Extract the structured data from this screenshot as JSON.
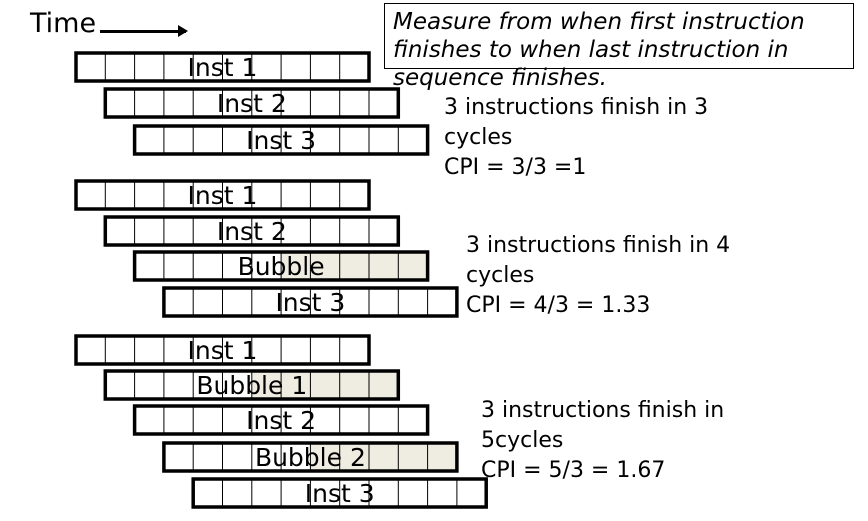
{
  "header": {
    "time_label": "Time"
  },
  "note": {
    "lines": [
      "Measure from when first instruction",
      "finishes to when last instruction in",
      "sequence finishes."
    ]
  },
  "scenarios": [
    {
      "caption": [
        "3 instructions finish in 3",
        "cycles",
        "CPI = 3/3 =1"
      ],
      "rows": [
        {
          "label": "Inst 1",
          "bubble": false
        },
        {
          "label": "Inst 2",
          "bubble": false
        },
        {
          "label": "Inst 3",
          "bubble": false
        }
      ]
    },
    {
      "caption": [
        "3 instructions finish in 4",
        "cycles",
        "CPI = 4/3 = 1.33"
      ],
      "rows": [
        {
          "label": "Inst 1",
          "bubble": false
        },
        {
          "label": "Inst 2",
          "bubble": false
        },
        {
          "label": "Bubble",
          "bubble": true
        },
        {
          "label": "Inst 3",
          "bubble": false
        }
      ]
    },
    {
      "caption": [
        "3 instructions finish in",
        "5cycles",
        "CPI = 5/3 = 1.67"
      ],
      "rows": [
        {
          "label": "Inst 1",
          "bubble": false
        },
        {
          "label": "Bubble 1",
          "bubble": true
        },
        {
          "label": "Inst 2",
          "bubble": false
        },
        {
          "label": "Bubble 2",
          "bubble": true
        },
        {
          "label": "Inst 3",
          "bubble": false
        }
      ]
    }
  ],
  "colors": {
    "bubble_fill": "#efede2",
    "stroke": "#000000"
  }
}
